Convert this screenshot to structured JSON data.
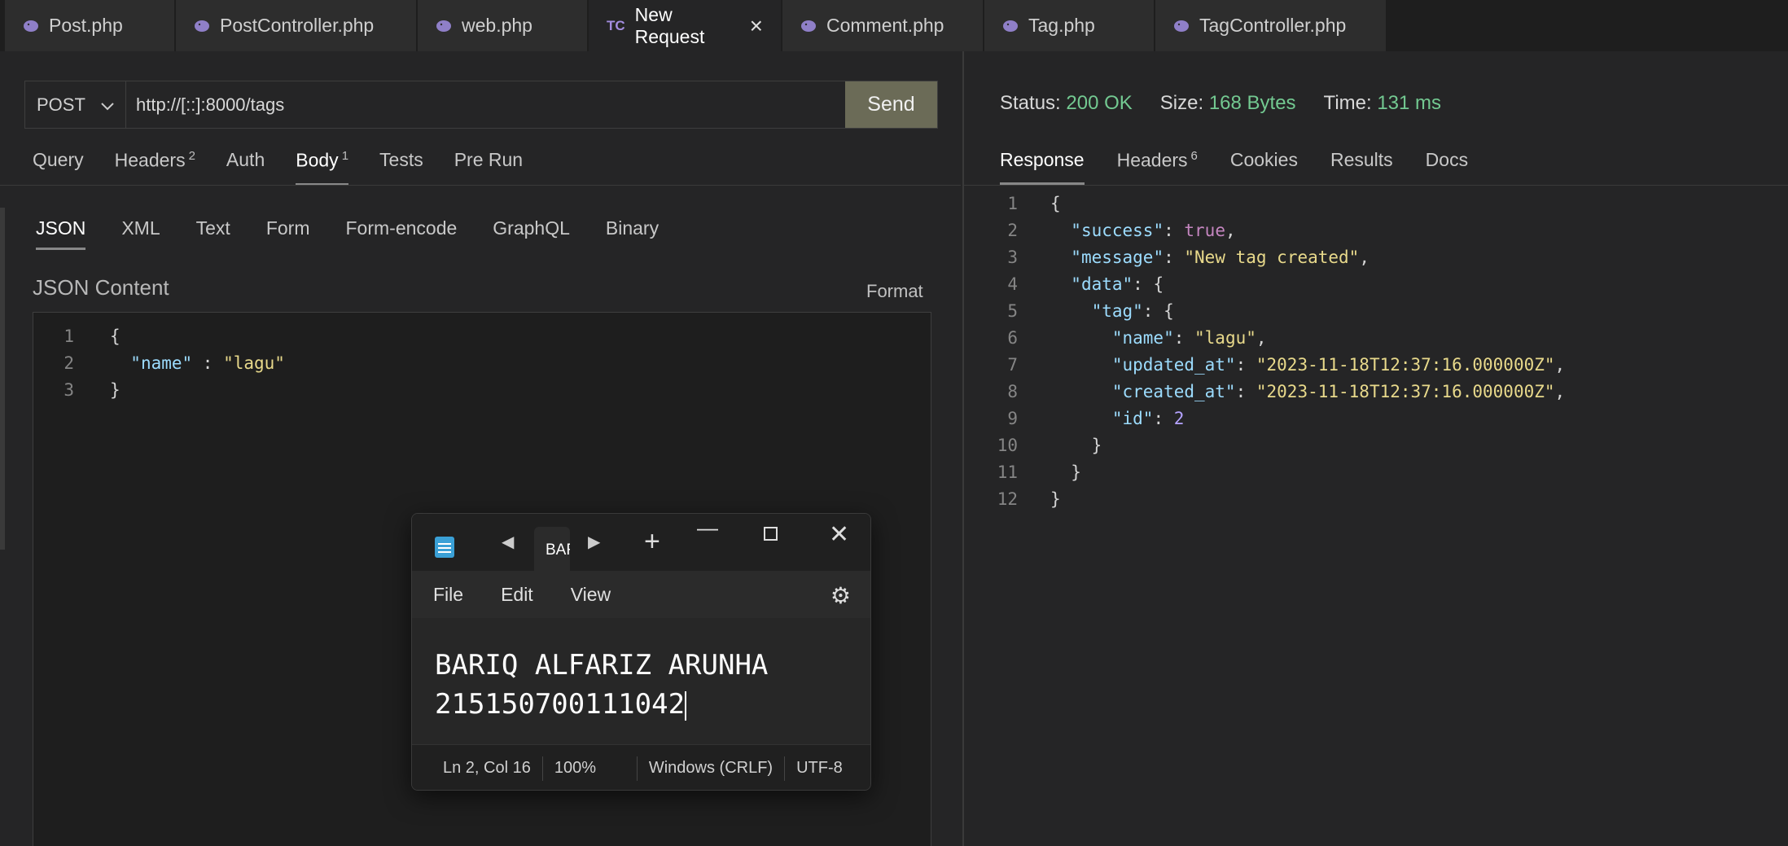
{
  "tabs": [
    {
      "label": "Post.php",
      "icon": "php-elephant-icon"
    },
    {
      "label": "PostController.php",
      "icon": "php-elephant-icon"
    },
    {
      "label": "web.php",
      "icon": "php-elephant-icon"
    },
    {
      "label": "New Request",
      "icon": "TC",
      "active": true
    },
    {
      "label": "Comment.php",
      "icon": "php-elephant-icon"
    },
    {
      "label": "Tag.php",
      "icon": "php-elephant-icon"
    },
    {
      "label": "TagController.php",
      "icon": "php-elephant-icon"
    }
  ],
  "request": {
    "method": "POST",
    "url": "http://[::]:8000/tags",
    "send_label": "Send",
    "tabs": {
      "query": "Query",
      "headers": "Headers",
      "headers_count": "2",
      "auth": "Auth",
      "body": "Body",
      "body_count": "1",
      "tests": "Tests",
      "prerun": "Pre Run"
    },
    "body_tabs": {
      "json": "JSON",
      "xml": "XML",
      "text": "Text",
      "form": "Form",
      "form_encode": "Form-encode",
      "graphql": "GraphQL",
      "binary": "Binary"
    },
    "content_label": "JSON Content",
    "format_label": "Format",
    "lines": [
      "1",
      "2",
      "3"
    ],
    "json_name_key": "\"name\"",
    "json_name_value": "\"lagu\""
  },
  "response": {
    "status_label": "Status:",
    "status_value": "200 OK",
    "size_label": "Size:",
    "size_value": "168 Bytes",
    "time_label": "Time:",
    "time_value": "131 ms",
    "tabs": {
      "response": "Response",
      "headers": "Headers",
      "headers_count": "6",
      "cookies": "Cookies",
      "results": "Results",
      "docs": "Docs"
    },
    "lines": [
      "1",
      "2",
      "3",
      "4",
      "5",
      "6",
      "7",
      "8",
      "9",
      "10",
      "11",
      "12"
    ],
    "success_key": "\"success\"",
    "success_value": "true",
    "message_key": "\"message\"",
    "message_value": "\"New tag created\"",
    "data_key": "\"data\"",
    "tag_key": "\"tag\"",
    "name_key": "\"name\"",
    "name_value": "\"lagu\"",
    "updated_key": "\"updated_at\"",
    "updated_value": "\"2023-11-18T12:37:16.000000Z\"",
    "created_key": "\"created_at\"",
    "created_value": "\"2023-11-18T12:37:16.000000Z\"",
    "id_key": "\"id\"",
    "id_value": "2"
  },
  "notepad": {
    "tab_label": "BAR",
    "menu": {
      "file": "File",
      "edit": "Edit",
      "view": "View"
    },
    "line1": "BARIQ ALFARIZ ARUNHA",
    "line2": "215150700111042",
    "status": {
      "position": "Ln 2, Col 16",
      "zoom": "100%",
      "eol": "Windows (CRLF)",
      "encoding": "UTF-8"
    }
  }
}
